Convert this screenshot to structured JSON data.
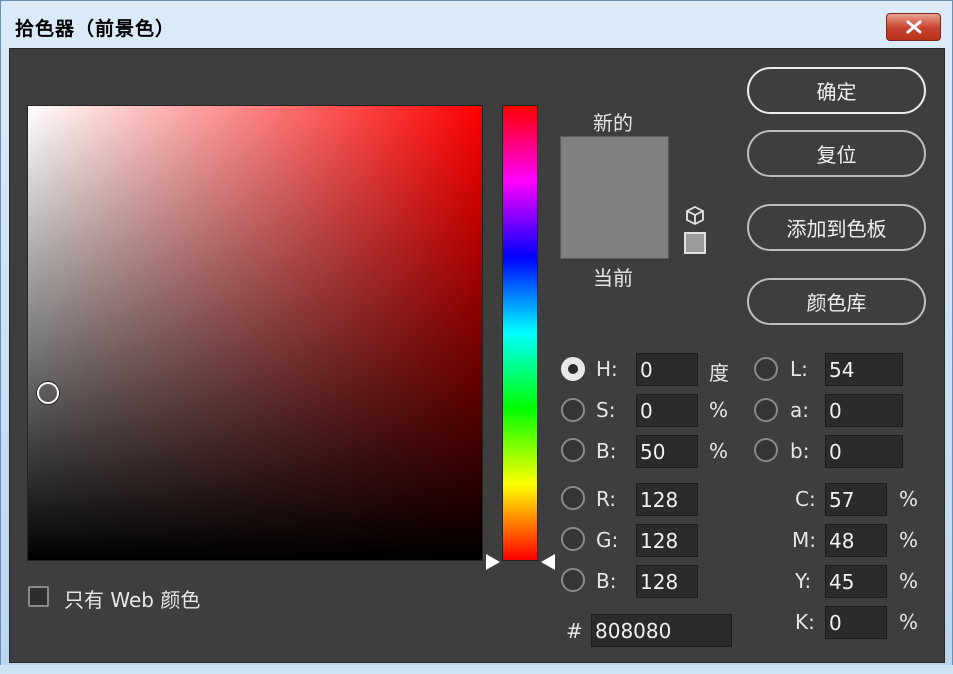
{
  "window": {
    "title": "拾色器（前景色）"
  },
  "picker": {
    "web_only_label": "只有 Web 颜色",
    "new_label": "新的",
    "current_label": "当前",
    "preview_color": "#808080"
  },
  "buttons": {
    "ok": "确定",
    "reset": "复位",
    "add_to_swatches": "添加到色板",
    "color_libraries": "颜色库"
  },
  "hsb": {
    "h": {
      "label": "H:",
      "value": "0",
      "unit": "度"
    },
    "s": {
      "label": "S:",
      "value": "0",
      "unit": "%"
    },
    "b": {
      "label": "B:",
      "value": "50",
      "unit": "%"
    }
  },
  "rgb": {
    "r": {
      "label": "R:",
      "value": "128"
    },
    "g": {
      "label": "G:",
      "value": "128"
    },
    "b": {
      "label": "B:",
      "value": "128"
    }
  },
  "lab": {
    "l": {
      "label": "L:",
      "value": "54"
    },
    "a": {
      "label": "a:",
      "value": "0"
    },
    "b": {
      "label": "b:",
      "value": "0"
    }
  },
  "cmyk": {
    "c": {
      "label": "C:",
      "value": "57",
      "unit": "%"
    },
    "m": {
      "label": "M:",
      "value": "48",
      "unit": "%"
    },
    "y": {
      "label": "Y:",
      "value": "45",
      "unit": "%"
    },
    "k": {
      "label": "K:",
      "value": "0",
      "unit": "%"
    }
  },
  "hex": {
    "label": "#",
    "value": "808080"
  }
}
